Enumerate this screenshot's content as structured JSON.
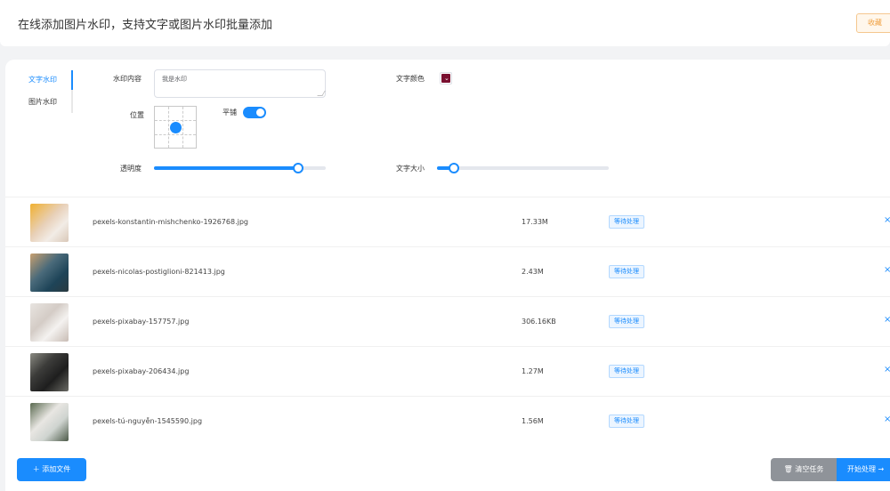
{
  "header": {
    "title": "在线添加图片水印，支持文字或图片水印批量添加",
    "fav_label": "收藏"
  },
  "tabs": [
    {
      "label": "文字水印",
      "active": true
    },
    {
      "label": "图片水印",
      "active": false
    }
  ],
  "form": {
    "content_label": "水印内容",
    "content_value": "我是水印",
    "position_label": "位置",
    "tile_label": "平铺",
    "tile_on": true,
    "color_label": "文字颜色",
    "color_value": "#7a1030",
    "opacity_label": "透明度",
    "opacity_fraction": 0.84,
    "size_label": "文字大小",
    "size_fraction": 0.1
  },
  "files": [
    {
      "name": "pexels-konstantin-mishchenko-1926768.jpg",
      "size": "17.33M",
      "status": "等待处理",
      "close": "×"
    },
    {
      "name": "pexels-nicolas-postiglioni-821413.jpg",
      "size": "2.43M",
      "status": "等待处理",
      "close": "×"
    },
    {
      "name": "pexels-pixabay-157757.jpg",
      "size": "306.16KB",
      "status": "等待处理",
      "close": "×"
    },
    {
      "name": "pexels-pixabay-206434.jpg",
      "size": "1.27M",
      "status": "等待处理",
      "close": "×"
    },
    {
      "name": "pexels-tú-nguyễn-1545590.jpg",
      "size": "1.56M",
      "status": "等待处理",
      "close": "×"
    }
  ],
  "footer": {
    "add_label": "＋ 添加文件",
    "clear_label": "🗑 清空任务",
    "start_label": "开始处理 →"
  }
}
